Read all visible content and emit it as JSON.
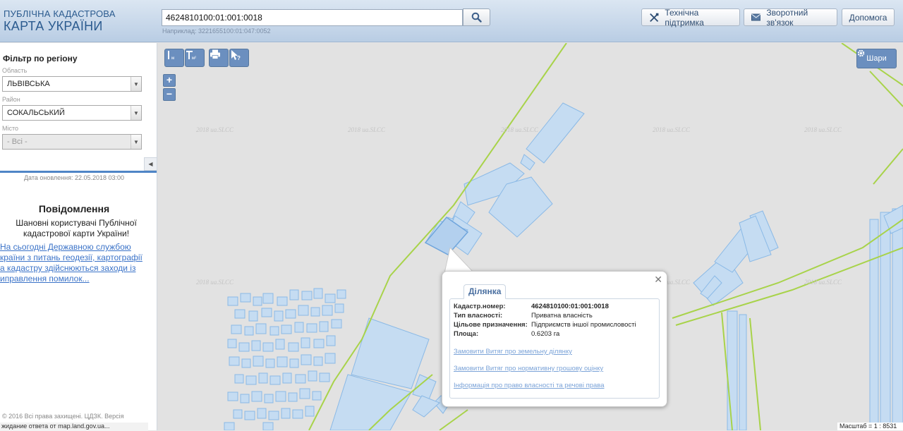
{
  "header": {
    "logo_line1": "ПУБЛІЧНА КАДАСТРОВА",
    "logo_line2": "КАРТА УКРАЇНИ",
    "search_value": "4624810100:01:001:0018",
    "search_hint": "Наприклад: 3221655100:01:047:0052",
    "support_label": "Технічна підтримка",
    "feedback_label": "Зворотний зв'язок",
    "help_label": "Допомога"
  },
  "sidebar": {
    "filter_title": "Фільтр по регіону",
    "oblast_label": "Область",
    "oblast_value": "ЛЬВІВСЬКА",
    "rayon_label": "Район",
    "rayon_value": "СОКАЛЬСЬКИЙ",
    "misto_label": "Місто",
    "misto_value": "- Всі -",
    "update_date": "Дата оновлення: 22.05.2018 03:00",
    "notice_title": "Повідомлення",
    "notice_text": "Шановні користувачі Публічної кадастрової карти України!",
    "notice_link": "   На сьогодні Державною службою\nкраїни з питань геодезії, картографії\nа кадастру здійснюються заходи із\nиправлення помилок...",
    "copyright": "© 2016 Всі права захищені. ЦДЗК. Версія",
    "status_text": "жидание ответа от map.land.gov.ua..."
  },
  "map": {
    "layers_label": "Шари",
    "scale_text": "Масштаб = 1 : 8531",
    "watermark": "2018 ua.SLCC",
    "colors": {
      "parcel_fill": "#c5dcf2",
      "parcel_stroke": "#8ab9e6",
      "boundary_line": "#a8d34a",
      "background": "#e2e2e2"
    }
  },
  "popup": {
    "tab_label": "Ділянка",
    "rows": [
      {
        "key": "Кадастр.номер:",
        "value": "4624810100:01:001:0018"
      },
      {
        "key": "Тип власності:",
        "value": "Приватна власність"
      },
      {
        "key": "Цільове призначення:",
        "value": "Підприємств іншої промисловості"
      },
      {
        "key": "Площа:",
        "value": "0.6203 га"
      }
    ],
    "links": [
      "Замовити Витяг про земельну ділянку",
      "Замовити Витяг про нормативну грошову оцінку",
      "Інформація про право власності та речові права"
    ]
  }
}
